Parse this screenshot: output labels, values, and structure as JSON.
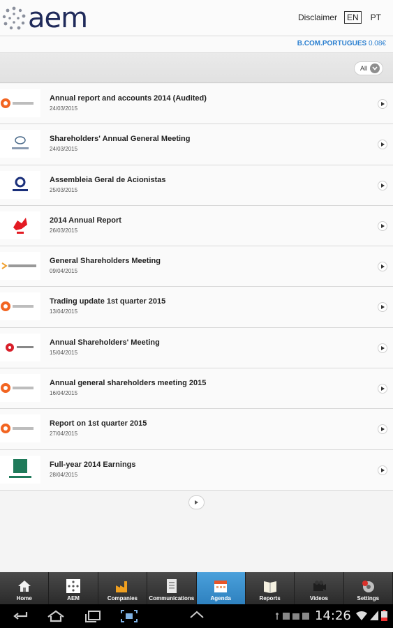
{
  "header": {
    "logo_text": "aem",
    "disclaimer": "Disclaimer",
    "lang_en": "EN",
    "lang_pt": "PT"
  },
  "ticker": {
    "symbol": "B.COM.PORTUGUES",
    "value": "0.08€"
  },
  "filter": {
    "label": "All"
  },
  "items": [
    {
      "title": "Annual report and accounts 2014 (Audited)",
      "date": "24/03/2015",
      "company_logo": "galp-energia"
    },
    {
      "title": "Shareholders' Annual General Meeting",
      "date": "24/03/2015",
      "company_logo": "bank-logo"
    },
    {
      "title": "Assembleia Geral de Acionistas",
      "date": "25/03/2015",
      "company_logo": "cimpor"
    },
    {
      "title": "2014 Annual Report",
      "date": "26/03/2015",
      "company_logo": "ctt"
    },
    {
      "title": "General Shareholders Meeting",
      "date": "09/04/2015",
      "company_logo": "semapa"
    },
    {
      "title": "Trading update 1st quarter 2015",
      "date": "13/04/2015",
      "company_logo": "galp-energia"
    },
    {
      "title": "Annual Shareholders' Meeting",
      "date": "15/04/2015",
      "company_logo": "red-flower-logo"
    },
    {
      "title": "Annual general shareholders meeting 2015",
      "date": "16/04/2015",
      "company_logo": "galp-energia"
    },
    {
      "title": "Report on 1st quarter 2015",
      "date": "27/04/2015",
      "company_logo": "galp-energia"
    },
    {
      "title": "Full-year 2014 Earnings",
      "date": "28/04/2015",
      "company_logo": "sdc-investimentos"
    }
  ],
  "nav": [
    {
      "label": "Home",
      "icon": "home-icon"
    },
    {
      "label": "AEM",
      "icon": "aem-icon"
    },
    {
      "label": "Companies",
      "icon": "factory-icon"
    },
    {
      "label": "Communications",
      "icon": "document-icon"
    },
    {
      "label": "Agenda",
      "icon": "calendar-icon",
      "active": true
    },
    {
      "label": "Reports",
      "icon": "book-icon"
    },
    {
      "label": "Videos",
      "icon": "camera-icon"
    },
    {
      "label": "Settings",
      "icon": "settings-icon"
    }
  ],
  "status": {
    "time": "14:26"
  },
  "colors": {
    "accent": "#2e81bf",
    "link": "#2a7fd0",
    "logo": "#1f2a5a"
  }
}
